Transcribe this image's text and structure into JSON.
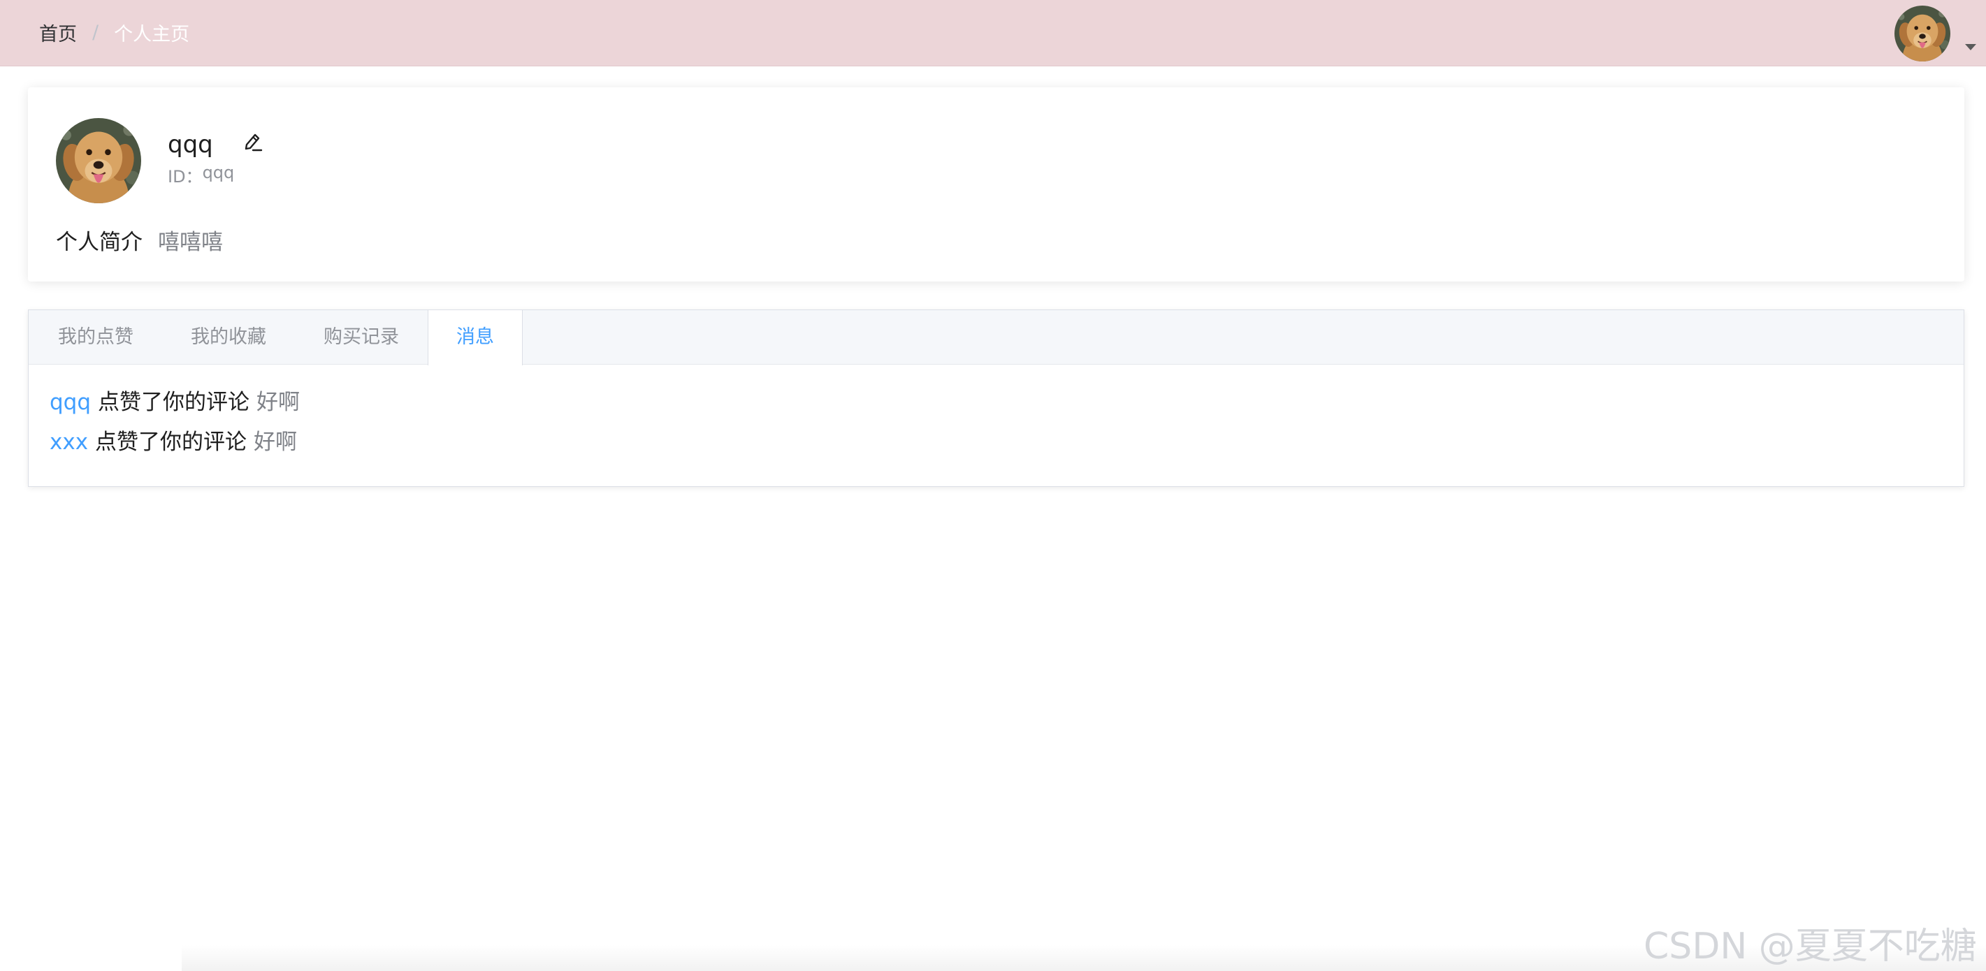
{
  "header": {
    "breadcrumb": {
      "home": "首页",
      "separator": "/",
      "current": "个人主页"
    },
    "avatar_icon": "golden-retriever-avatar",
    "dropdown_icon": "caret-down-icon"
  },
  "profile": {
    "name": "qqq",
    "edit_icon": "pencil-edit-icon",
    "id_label": "ID：",
    "id_value": "qqq",
    "bio_label": "个人简介",
    "bio_value": "嘻嘻嘻"
  },
  "tabs": {
    "items": [
      {
        "label": "我的点赞",
        "active": false
      },
      {
        "label": "我的收藏",
        "active": false
      },
      {
        "label": "购买记录",
        "active": false
      },
      {
        "label": "消息",
        "active": true
      }
    ]
  },
  "messages": [
    {
      "user": "qqq",
      "action": "点赞了你的评论",
      "comment": "好啊"
    },
    {
      "user": "xxx",
      "action": "点赞了你的评论",
      "comment": "好啊"
    }
  ],
  "watermark": "CSDN @夏夏不吃糖",
  "colors": {
    "header_bg": "#ecd5d8",
    "accent": "#409eff",
    "muted_text": "#909399"
  }
}
